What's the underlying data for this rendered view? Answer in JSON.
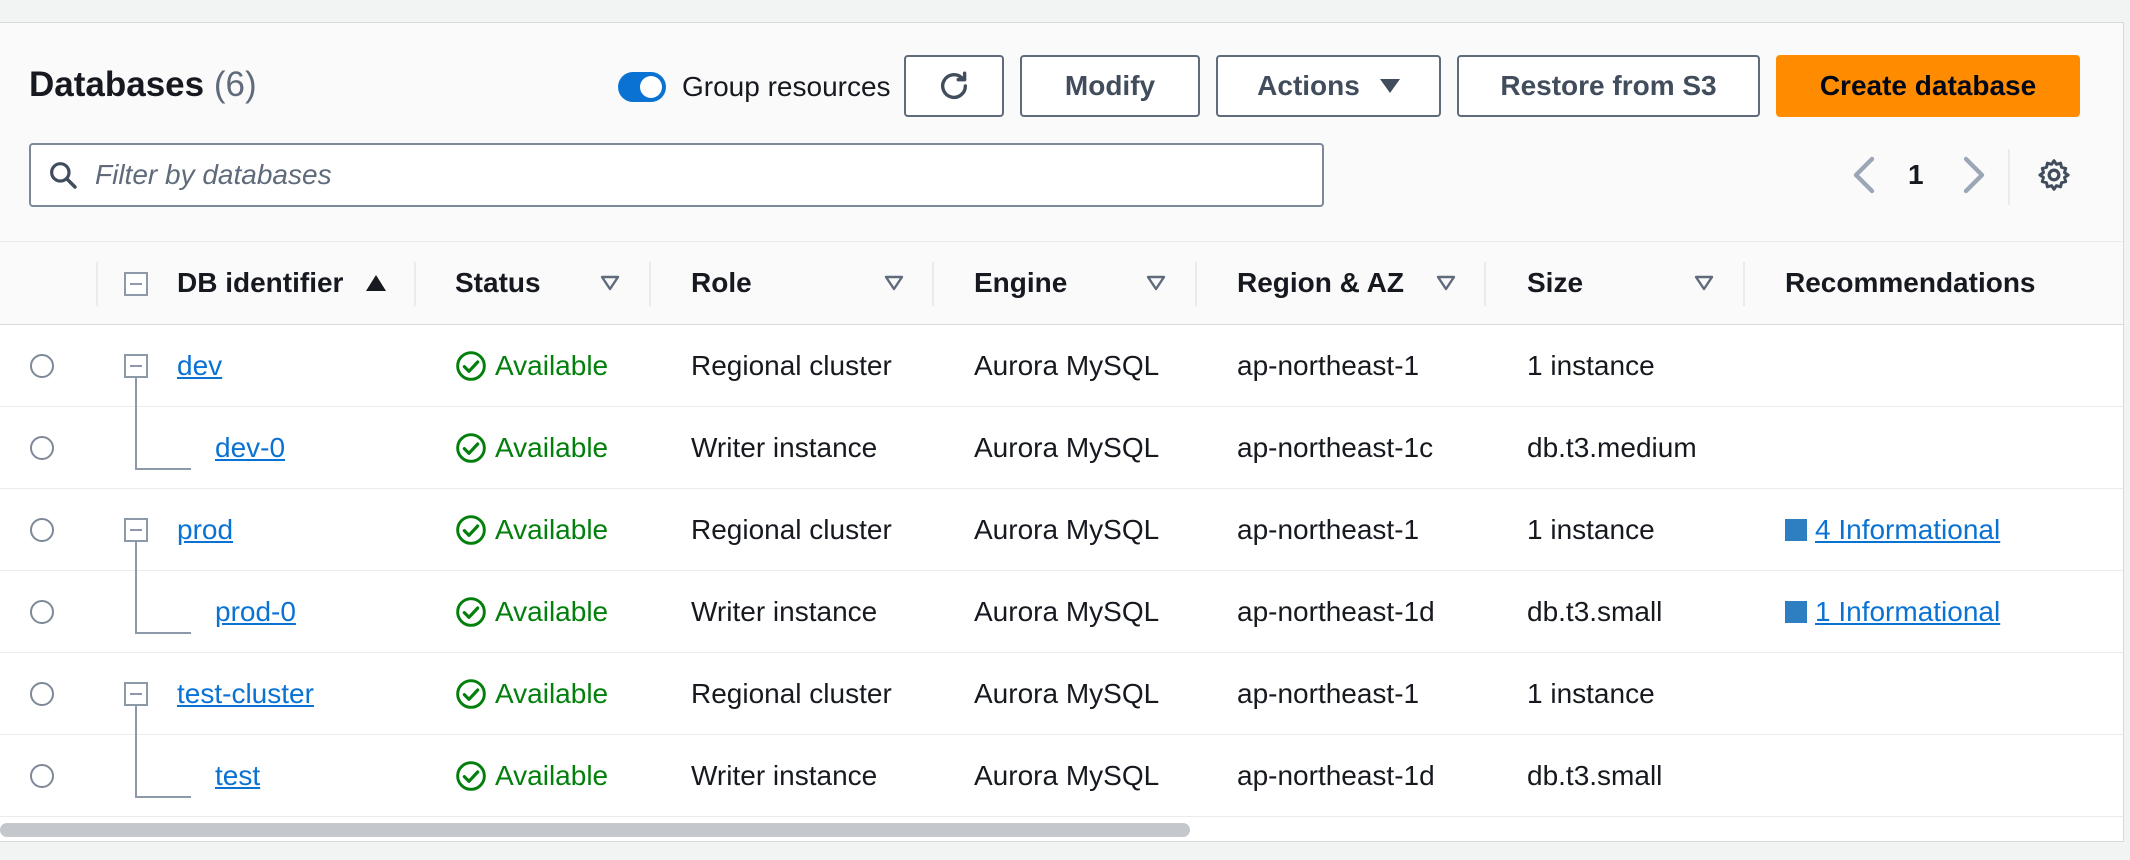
{
  "header": {
    "title": "Databases",
    "count": "(6)",
    "toggle_label": "Group resources",
    "toggle_on": true
  },
  "toolbar": {
    "modify_label": "Modify",
    "actions_label": "Actions",
    "restore_label": "Restore from S3",
    "create_label": "Create database"
  },
  "search": {
    "placeholder": "Filter by databases"
  },
  "pagination": {
    "current_page": "1"
  },
  "table": {
    "columns": [
      "DB identifier",
      "Status",
      "Role",
      "Engine",
      "Region & AZ",
      "Size",
      "Recommendations"
    ],
    "rows": [
      {
        "id": "dev",
        "status": "Available",
        "role": "Regional cluster",
        "engine": "Aurora MySQL",
        "region": "ap-northeast-1",
        "size": "1 instance",
        "rec": ""
      },
      {
        "id": "dev-0",
        "status": "Available",
        "role": "Writer instance",
        "engine": "Aurora MySQL",
        "region": "ap-northeast-1c",
        "size": "db.t3.medium",
        "rec": ""
      },
      {
        "id": "prod",
        "status": "Available",
        "role": "Regional cluster",
        "engine": "Aurora MySQL",
        "region": "ap-northeast-1",
        "size": "1 instance",
        "rec": "4 Informational"
      },
      {
        "id": "prod-0",
        "status": "Available",
        "role": "Writer instance",
        "engine": "Aurora MySQL",
        "region": "ap-northeast-1d",
        "size": "db.t3.small",
        "rec": "1 Informational"
      },
      {
        "id": "test-cluster",
        "status": "Available",
        "role": "Regional cluster",
        "engine": "Aurora MySQL",
        "region": "ap-northeast-1",
        "size": "1 instance",
        "rec": ""
      },
      {
        "id": "test",
        "status": "Available",
        "role": "Writer instance",
        "engine": "Aurora MySQL",
        "region": "ap-northeast-1d",
        "size": "db.t3.small",
        "rec": ""
      }
    ]
  },
  "colors": {
    "accent": "#0972d3",
    "primary_button": "#ff8c00",
    "status_green": "#037f0c",
    "recommendation_blue": "#2d7fc1"
  }
}
